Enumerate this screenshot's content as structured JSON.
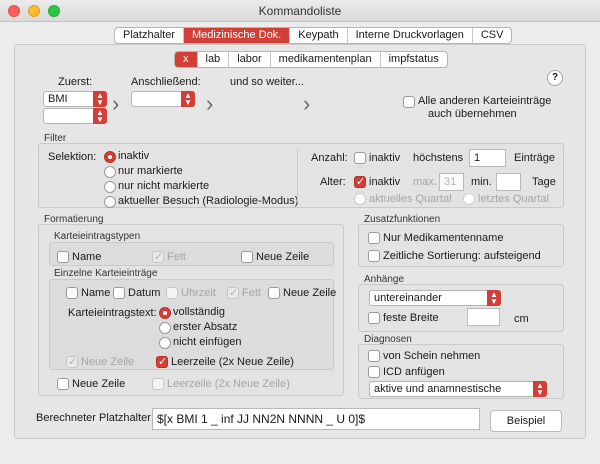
{
  "window": {
    "title": "Kommandoliste"
  },
  "main_tabs": [
    {
      "label": "Platzhalter",
      "active": false
    },
    {
      "label": "Medizinische Dok.",
      "active": true
    },
    {
      "label": "Keypath",
      "active": false
    },
    {
      "label": "Interne Druckvorlagen",
      "active": false
    },
    {
      "label": "CSV",
      "active": false
    }
  ],
  "sub_tabs": [
    {
      "label": "x",
      "active": true
    },
    {
      "label": "lab",
      "active": false
    },
    {
      "label": "labor",
      "active": false
    },
    {
      "label": "medikamentenplan",
      "active": false
    },
    {
      "label": "impfstatus",
      "active": false
    }
  ],
  "top": {
    "first_label": "Zuerst:",
    "first_value": "BMI",
    "second_value": "",
    "then_label": "Anschließend:",
    "then_value": "",
    "etc_label": "und so weiter...",
    "help": "?",
    "copy_all_label_1": "Alle anderen Karteieinträge",
    "copy_all_label_2": "auch übernehmen"
  },
  "filter": {
    "title": "Filter",
    "selection_label": "Selektion:",
    "options": [
      "inaktiv",
      "nur markierte",
      "nur nicht markierte",
      "aktueller Besuch (Radiologie-Modus)"
    ],
    "count_label": "Anzahl:",
    "count_inactive": "inaktiv",
    "max_label": "höchstens",
    "max_value": "1",
    "entries_label": "Einträge",
    "age_label": "Alter:",
    "age_inactive": "inaktiv",
    "age_max_label": "max.",
    "age_max_value": "31",
    "age_min_label": "min.",
    "age_min_value": "",
    "days_label": "Tage",
    "current_quarter": "aktuelles Quartal",
    "last_quarter": "letztes Quartal"
  },
  "format": {
    "title": "Formatierung",
    "types_title": "Karteieintragstypen",
    "name": "Name",
    "bold": "Fett",
    "new_line": "Neue Zeile",
    "entries_title": "Einzelne Karteieinträge",
    "date": "Datum",
    "time": "Uhrzeit",
    "text_label": "Karteieintragstext:",
    "text_options": [
      "vollständig",
      "erster Absatz",
      "nicht einfügen"
    ],
    "blank_line": "Leerzeile (2x Neue Zeile)"
  },
  "extra": {
    "title": "Zusatzfunktionen",
    "only_med": "Nur Medikamentenname",
    "time_sort": "Zeitliche Sortierung: aufsteigend"
  },
  "attach": {
    "title": "Anhänge",
    "mode_value": "untereinander",
    "fixed_width": "feste Breite",
    "width_value": "",
    "unit": "cm"
  },
  "diag": {
    "title": "Diagnosen",
    "from_bill": "von Schein nehmen",
    "icd": "ICD anfügen",
    "type_value": "aktive und anamnestische"
  },
  "footer": {
    "computed_label": "Berechneter Platzhalter:",
    "computed_value": "$[x BMI 1 _ inf JJ NN2N NNNN _ U 0]$",
    "example_button": "Beispiel"
  },
  "colors": {
    "accent": "#d23f37"
  }
}
